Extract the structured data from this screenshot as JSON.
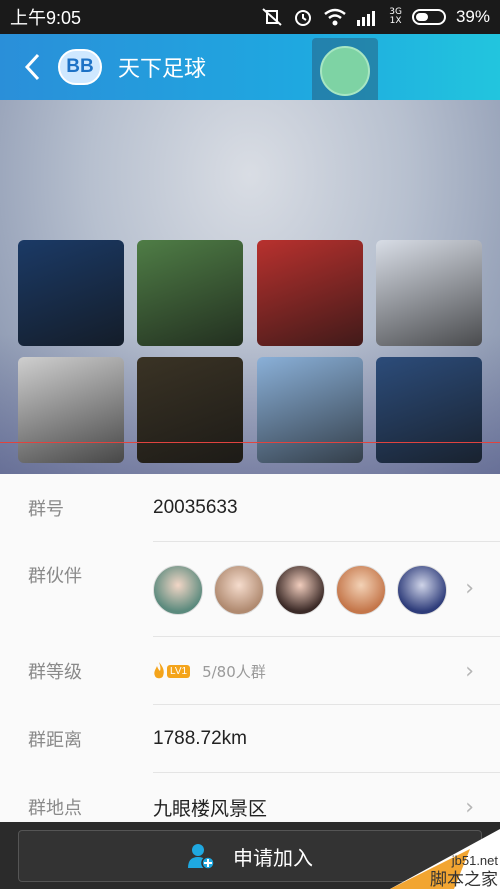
{
  "status_bar": {
    "time": "上午9:05",
    "network_top": "3G",
    "network_bottom": "1X",
    "battery": "39%"
  },
  "header": {
    "title": "天下足球",
    "logo_text": "BB"
  },
  "photos": [
    {
      "name": "photo-barcelona-team",
      "bg": "#1b3a66"
    },
    {
      "name": "photo-stadium",
      "bg": "#4f7d46"
    },
    {
      "name": "photo-spain-celebration",
      "bg": "#b8312e"
    },
    {
      "name": "photo-real-madrid-celebration",
      "bg": "#d8dde6"
    },
    {
      "name": "photo-ronaldo",
      "bg": "#cfcfcf"
    },
    {
      "name": "photo-messi-ballon-dor",
      "bg": "#3a3325"
    },
    {
      "name": "photo-messi-argentina",
      "bg": "#8ab0d8"
    },
    {
      "name": "photo-messi-portrait",
      "bg": "#2c4c7a"
    }
  ],
  "info": {
    "group_id_label": "群号",
    "group_id_value": "20035633",
    "members_label": "群伙伴",
    "level_label": "群等级",
    "level_badge": "LV1",
    "level_count": "5/80人群",
    "distance_label": "群距离",
    "distance_value": "1788.72km",
    "location_label": "群地点",
    "location_value": "九眼楼风景区"
  },
  "bottom": {
    "join_label": "申请加入"
  },
  "watermark": {
    "site": "jb51.net",
    "name": "脚本之家"
  }
}
